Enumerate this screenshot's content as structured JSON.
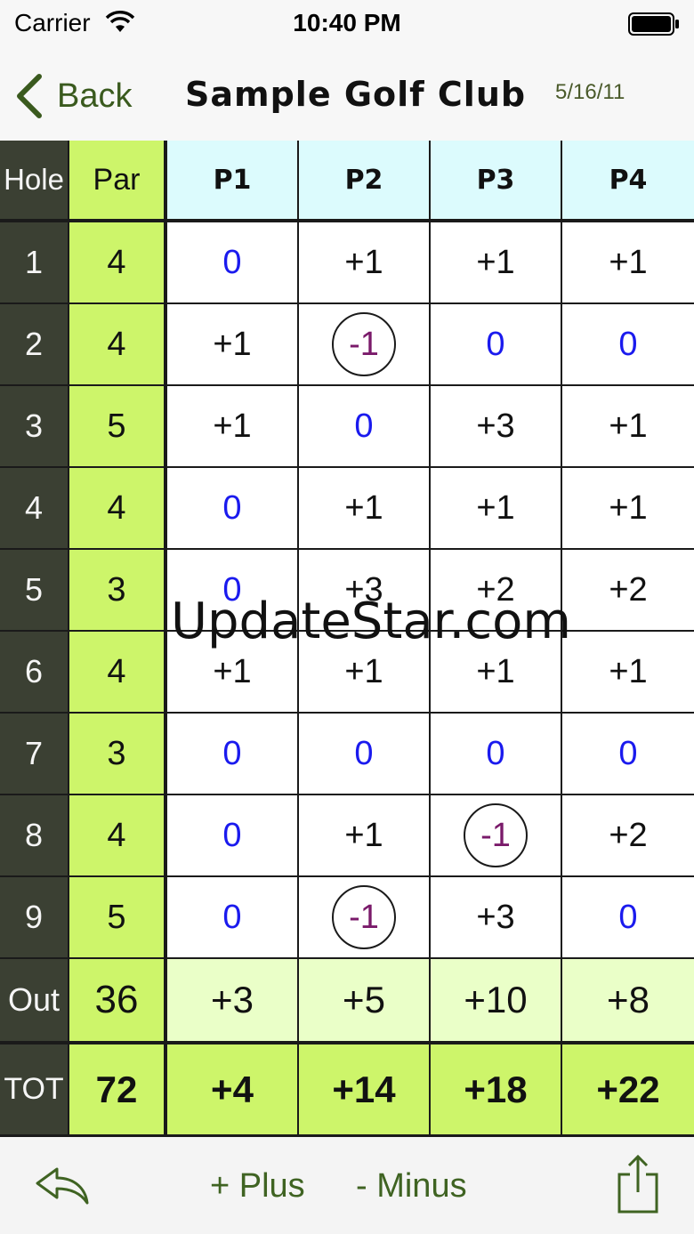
{
  "status_bar": {
    "carrier": "Carrier",
    "time": "10:40 PM"
  },
  "nav": {
    "back_label": "Back",
    "title": "Sample Golf Club",
    "date": "5/16/11"
  },
  "scorecard": {
    "headers": {
      "hole": "Hole",
      "par": "Par",
      "players": [
        "P1",
        "P2",
        "P3",
        "P4"
      ]
    },
    "holes": [
      {
        "hole": "1",
        "par": "4",
        "scores": [
          "0",
          "+1",
          "+1",
          "+1"
        ]
      },
      {
        "hole": "2",
        "par": "4",
        "scores": [
          "+1",
          "-1",
          "0",
          "0"
        ]
      },
      {
        "hole": "3",
        "par": "5",
        "scores": [
          "+1",
          "0",
          "+3",
          "+1"
        ]
      },
      {
        "hole": "4",
        "par": "4",
        "scores": [
          "0",
          "+1",
          "+1",
          "+1"
        ]
      },
      {
        "hole": "5",
        "par": "3",
        "scores": [
          "0",
          "+3",
          "+2",
          "+2"
        ]
      },
      {
        "hole": "6",
        "par": "4",
        "scores": [
          "+1",
          "+1",
          "+1",
          "+1"
        ]
      },
      {
        "hole": "7",
        "par": "3",
        "scores": [
          "0",
          "0",
          "0",
          "0"
        ]
      },
      {
        "hole": "8",
        "par": "4",
        "scores": [
          "0",
          "+1",
          "-1",
          "+2"
        ]
      },
      {
        "hole": "9",
        "par": "5",
        "scores": [
          "0",
          "-1",
          "+3",
          "0"
        ]
      }
    ],
    "out": {
      "label": "Out",
      "par": "36",
      "scores": [
        "+3",
        "+5",
        "+10",
        "+8"
      ]
    },
    "tot": {
      "label": "TOT",
      "par": "72",
      "scores": [
        "+4",
        "+14",
        "+18",
        "+22"
      ]
    }
  },
  "watermark": "UpdateStar.com",
  "toolbar": {
    "plus_label": "+ Plus",
    "minus_label": "- Minus",
    "undo_icon": "reply-icon",
    "share_icon": "share-icon"
  },
  "colors": {
    "hole_column": "#3b4033",
    "par_column": "#cdf56a",
    "header_players": "#dcfbfd",
    "even_par": "#1a1aee",
    "birdie": "#7a1a6a",
    "out_row": "#eaffc8",
    "accent": "#3a5a1e"
  }
}
